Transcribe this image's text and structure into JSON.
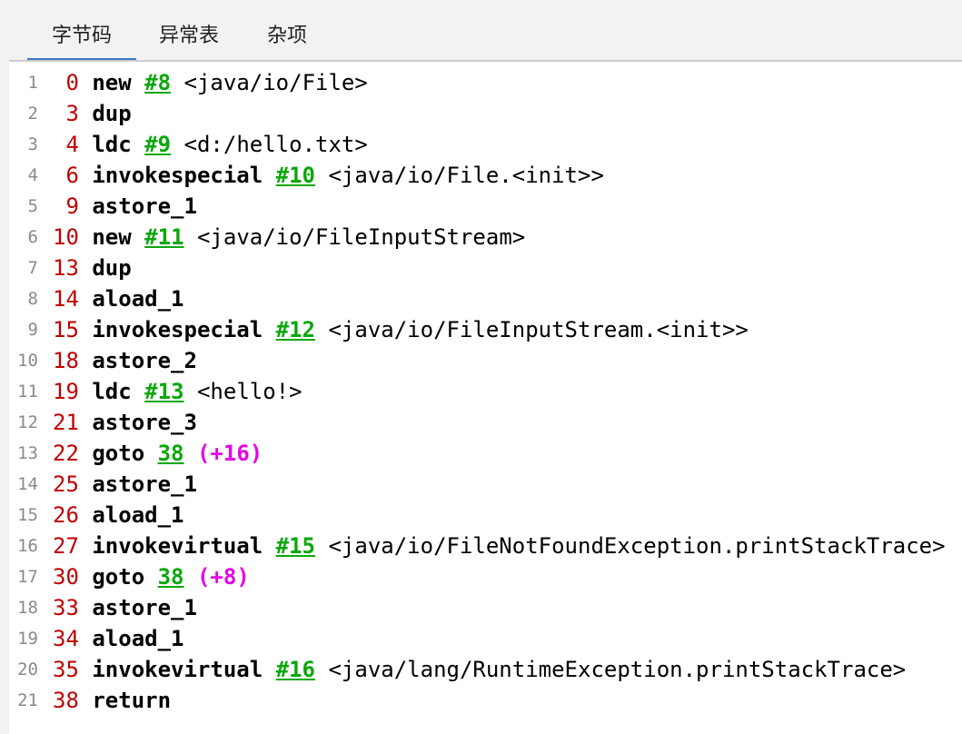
{
  "tabs": [
    {
      "label": "字节码",
      "active": true
    },
    {
      "label": "异常表",
      "active": false
    },
    {
      "label": "杂项",
      "active": false
    }
  ],
  "colors": {
    "accent": "#3a78c3",
    "offset": "#c00000",
    "reference": "#0aa80a",
    "delta": "#e600e6"
  },
  "code": [
    {
      "num": "1",
      "off": " 0",
      "op": "new",
      "ref": "#8",
      "comment": "<java/io/File>"
    },
    {
      "num": "2",
      "off": " 3",
      "op": "dup"
    },
    {
      "num": "3",
      "off": " 4",
      "op": "ldc",
      "ref": "#9",
      "comment": "<d:/hello.txt>"
    },
    {
      "num": "4",
      "off": " 6",
      "op": "invokespecial",
      "ref": "#10",
      "comment": "<java/io/File.<init>>"
    },
    {
      "num": "5",
      "off": " 9",
      "op": "astore_1"
    },
    {
      "num": "6",
      "off": "10",
      "op": "new",
      "ref": "#11",
      "comment": "<java/io/FileInputStream>"
    },
    {
      "num": "7",
      "off": "13",
      "op": "dup"
    },
    {
      "num": "8",
      "off": "14",
      "op": "aload_1"
    },
    {
      "num": "9",
      "off": "15",
      "op": "invokespecial",
      "ref": "#12",
      "comment": "<java/io/FileInputStream.<init>>"
    },
    {
      "num": "10",
      "off": "18",
      "op": "astore_2"
    },
    {
      "num": "11",
      "off": "19",
      "op": "ldc",
      "ref": "#13",
      "comment": "<hello!>"
    },
    {
      "num": "12",
      "off": "21",
      "op": "astore_3"
    },
    {
      "num": "13",
      "off": "22",
      "op": "goto",
      "target": "38",
      "delta": "(+16)"
    },
    {
      "num": "14",
      "off": "25",
      "op": "astore_1"
    },
    {
      "num": "15",
      "off": "26",
      "op": "aload_1"
    },
    {
      "num": "16",
      "off": "27",
      "op": "invokevirtual",
      "ref": "#15",
      "comment": "<java/io/FileNotFoundException.printStackTrace>"
    },
    {
      "num": "17",
      "off": "30",
      "op": "goto",
      "target": "38",
      "delta": "(+8)"
    },
    {
      "num": "18",
      "off": "33",
      "op": "astore_1"
    },
    {
      "num": "19",
      "off": "34",
      "op": "aload_1"
    },
    {
      "num": "20",
      "off": "35",
      "op": "invokevirtual",
      "ref": "#16",
      "comment": "<java/lang/RuntimeException.printStackTrace>"
    },
    {
      "num": "21",
      "off": "38",
      "op": "return"
    }
  ]
}
